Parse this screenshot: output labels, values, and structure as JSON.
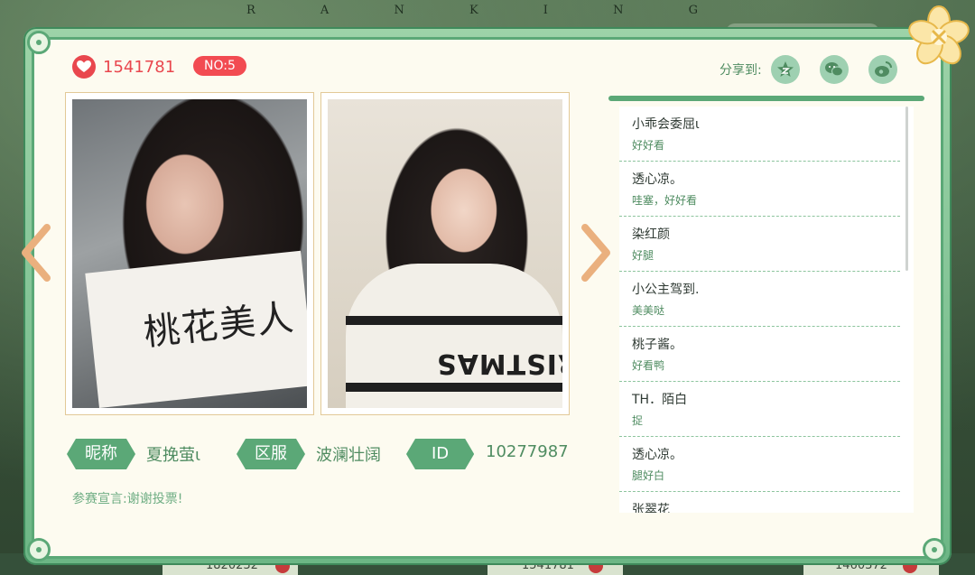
{
  "background": {
    "title": "R A N K I N G",
    "counts": [
      "1820232",
      "1541781",
      "1460372"
    ]
  },
  "header": {
    "likes": "1541781",
    "rank": "NO:5",
    "share_label": "分享到:",
    "share_targets": [
      "qzone-icon",
      "wechat-icon",
      "weibo-icon"
    ]
  },
  "photos": {
    "sign_text": "桃花美人",
    "sweater_text": "CHRISTMAS"
  },
  "info": {
    "nickname_label": "昵称",
    "nickname": "夏挽萤ι",
    "region_label": "区服",
    "region": "波澜壮阔",
    "id_label": "ID",
    "id": "10277987",
    "declaration_label": "参赛宣言:",
    "declaration": "谢谢投票!"
  },
  "comments": [
    {
      "name": "小乖会委屈ι",
      "text": "好好看"
    },
    {
      "name": "透心凉。",
      "text": "哇塞，好好看"
    },
    {
      "name": "染红颜",
      "text": "好腿"
    },
    {
      "name": "小公主驾到.",
      "text": "美美哒"
    },
    {
      "name": "桃子酱。",
      "text": "好看鸭"
    },
    {
      "name": "TH．陌白",
      "text": "捉"
    },
    {
      "name": "透心凉。",
      "text": "腿好白"
    },
    {
      "name": "张翠花",
      "text": ""
    }
  ],
  "colors": {
    "accent_green": "#5ba877",
    "heart_red": "#e9474e",
    "arrow_orange": "#eab07e",
    "panel_bg": "#fdfbf0"
  }
}
